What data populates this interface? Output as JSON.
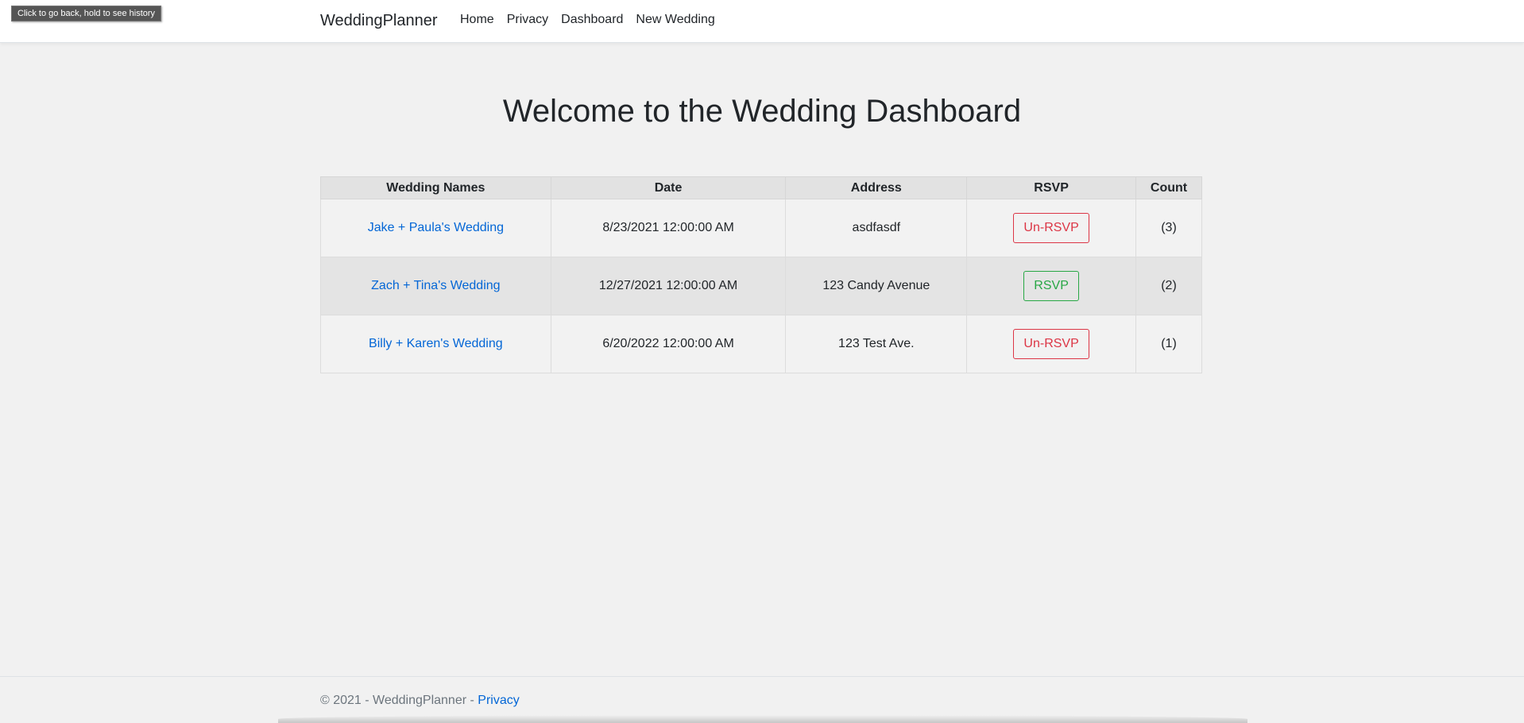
{
  "tooltip": {
    "text": "Click to go back, hold to see history"
  },
  "navbar": {
    "brand": "WeddingPlanner",
    "links": [
      "Home",
      "Privacy",
      "Dashboard",
      "New Wedding"
    ]
  },
  "main": {
    "title": "Welcome to the Wedding Dashboard",
    "table": {
      "headers": [
        "Wedding Names",
        "Date",
        "Address",
        "RSVP",
        "Count"
      ],
      "rows": [
        {
          "name": "Jake + Paula's Wedding",
          "date": "8/23/2021 12:00:00 AM",
          "address": "asdfasdf",
          "rsvp": "Un-RSVP",
          "count": "(3)"
        },
        {
          "name": "Zach + Tina's Wedding",
          "date": "12/27/2021 12:00:00 AM",
          "address": "123 Candy Avenue",
          "rsvp": "RSVP",
          "count": "(2)"
        },
        {
          "name": "Billy + Karen's Wedding",
          "date": "6/20/2022 12:00:00 AM",
          "address": "123 Test Ave.",
          "rsvp": "Un-RSVP",
          "count": "(1)"
        }
      ]
    }
  },
  "footer": {
    "text": "© 2021 - WeddingPlanner - ",
    "link": "Privacy"
  },
  "colors": {
    "link": "#0366d6",
    "danger": "#dc3545",
    "success": "#28a745",
    "page_background": "#f1f1f1"
  }
}
